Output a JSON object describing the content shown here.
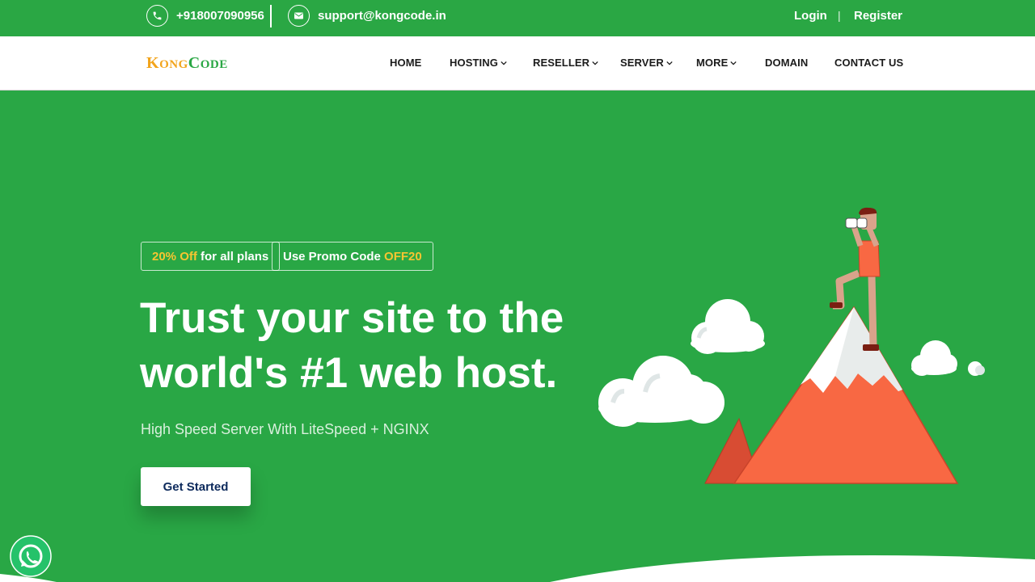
{
  "topbar": {
    "phone": "+918007090956",
    "email": "support@kongcode.in",
    "login": "Login",
    "separator": "|",
    "register": "Register",
    "phone_icon": "phone-icon",
    "email_icon": "envelope-icon"
  },
  "nav": {
    "logo": {
      "k1": "K",
      "ong": "ONG",
      "c1": "C",
      "ode": "ODE"
    },
    "items": [
      {
        "label": "HOME"
      },
      {
        "label": "HOSTING",
        "dropdown": true
      },
      {
        "label": "RESELLER",
        "dropdown": true
      },
      {
        "label": "SERVER",
        "dropdown": true
      },
      {
        "label": "MORE",
        "dropdown": true
      },
      {
        "label": "DOMAIN"
      },
      {
        "label": "CONTACT US"
      }
    ]
  },
  "hero": {
    "badge1": {
      "highlight": "20% Off",
      "text": " for all plans"
    },
    "badge2": {
      "text": "Use Promo Code ",
      "highlight": "OFF20"
    },
    "headline_line1": "Trust your site to the",
    "headline_line2": "world's #1 web host.",
    "subtitle": "High Speed Server With LiteSpeed + NGINX",
    "cta": "Get Started"
  },
  "floating": {
    "icon": "whatsapp-icon"
  },
  "colors": {
    "primary_green": "#29a745",
    "accent_yellow": "#f7c531",
    "logo_orange": "#f2a41c",
    "mountain": "#f86843",
    "cta_text": "#0d2a5c"
  }
}
